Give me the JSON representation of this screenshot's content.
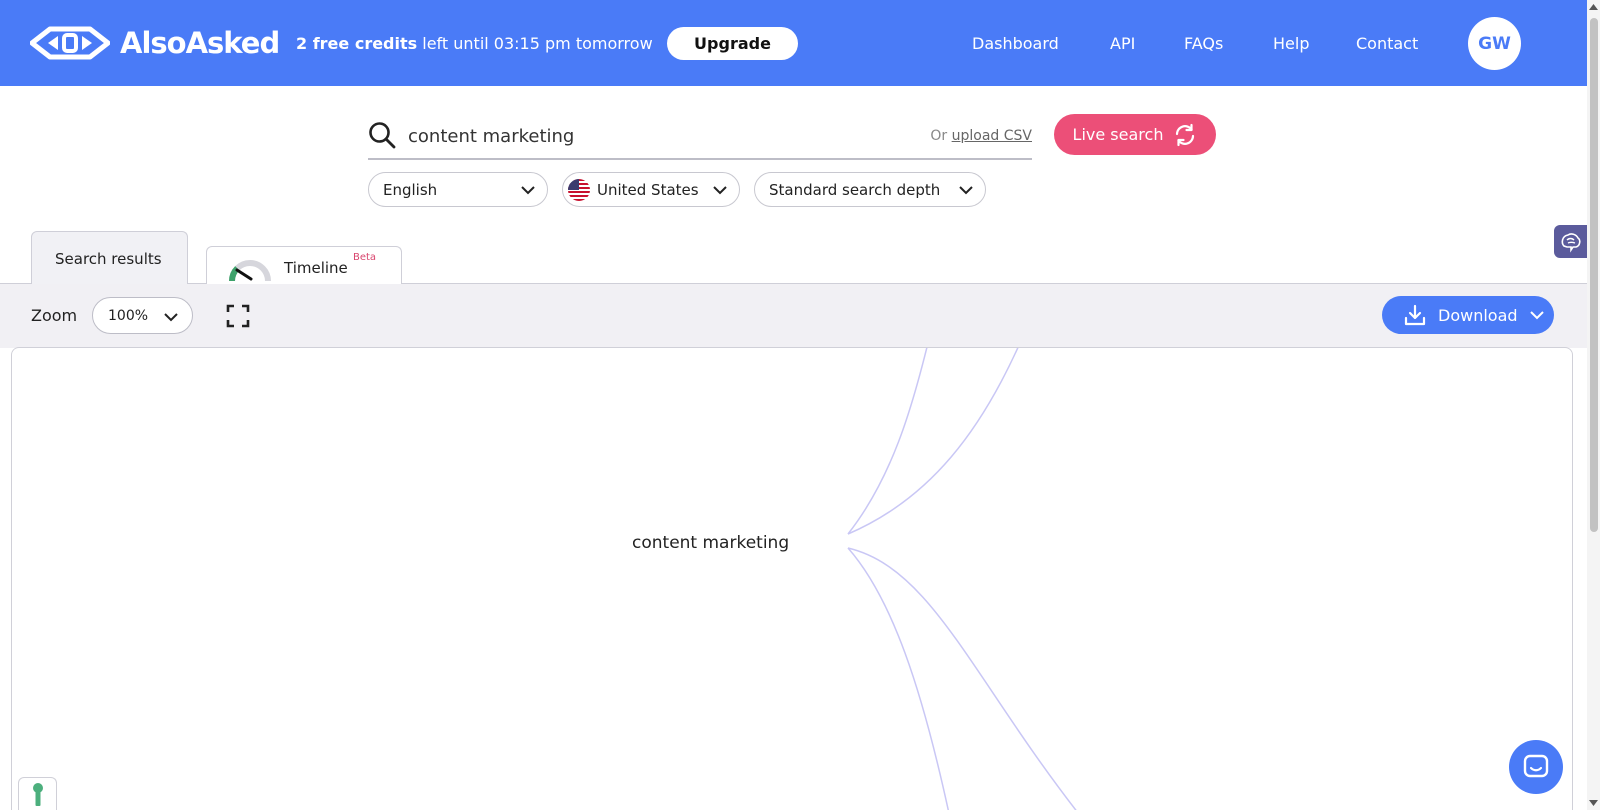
{
  "header": {
    "logo_text": "AlsoAsked",
    "credits_bold": "2 free credits",
    "credits_rest": " left until 03:15 pm tomorrow",
    "upgrade_label": "Upgrade",
    "nav": [
      "Dashboard",
      "API",
      "FAQs",
      "Help",
      "Contact"
    ],
    "avatar_initials": "GW"
  },
  "search": {
    "query": "content marketing",
    "csv_prefix": "Or ",
    "csv_link": "upload CSV",
    "live_search_label": "Live search",
    "language": "English",
    "country": "United States",
    "depth": "Standard search depth"
  },
  "tabs": [
    {
      "label": "Search results",
      "active": true
    },
    {
      "label": "Timeline",
      "badge": "Beta",
      "active": false
    }
  ],
  "toolbar": {
    "zoom_label": "Zoom",
    "zoom_value": "100%",
    "download_label": "Download"
  },
  "canvas": {
    "root_node": "content marketing"
  },
  "colors": {
    "primary": "#4a7bf7",
    "live_search": "#ec4f78",
    "edge": "#c9c7f5"
  }
}
